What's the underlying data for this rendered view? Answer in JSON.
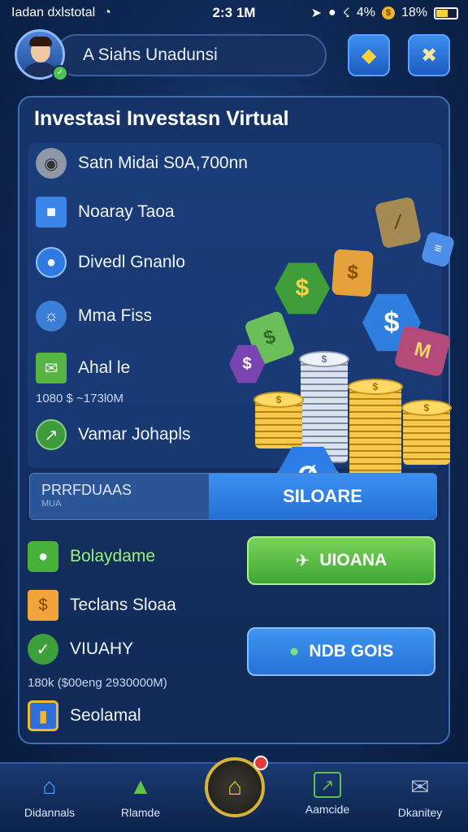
{
  "status_bar": {
    "carrier": "Iadan dxlstotal",
    "time": "2:3 1M",
    "battery_text": "4% ",
    "battery_level": "18%"
  },
  "header": {
    "name": "A Siahs Unadunsi"
  },
  "card": {
    "title": "Investasi Investasn Virtual",
    "items": [
      {
        "label": "Satn Midai S0A,700nn",
        "icon": "location-icon"
      },
      {
        "label": "Noaray Taoa",
        "icon": "folder-icon"
      },
      {
        "label": "Divedl Gnanlo",
        "icon": "map-pin-icon"
      },
      {
        "label": "Mma Fiss",
        "icon": "globe-icon"
      },
      {
        "label": "Ahal le",
        "icon": "mail-icon"
      },
      {
        "label": "Vamar Johapls",
        "icon": "chart-icon"
      }
    ],
    "sub_line_1": "1080 $ ~173l0M",
    "split": {
      "left_title": "PRRFDUAAS",
      "left_sub": "MUA",
      "right_label": "SILOARE"
    },
    "items2": [
      {
        "label": "Bolaydame",
        "icon": "wallet-icon"
      },
      {
        "label": "Teclans Sloaa",
        "icon": "money-icon"
      },
      {
        "label": "VIUAHY",
        "icon": "shield-icon"
      },
      {
        "label": "Seolamal",
        "icon": "calendar-icon"
      }
    ],
    "sub_line_2": "180k ($00eng 2930000M)",
    "btn_green": "UIOANA",
    "btn_blue": "NDB GOIS",
    "illus_coin_label": "$",
    "illus_hex_b": "Ø",
    "illus_card_m": "M"
  },
  "bottom_nav": [
    {
      "label": "Didannals",
      "icon": "house-icon"
    },
    {
      "label": "Rlamde",
      "icon": "graduation-cap-icon"
    },
    {
      "label": "Aamcide",
      "icon": "chart-box-icon"
    },
    {
      "label": "Dkanitey",
      "icon": "envelope-icon"
    }
  ]
}
